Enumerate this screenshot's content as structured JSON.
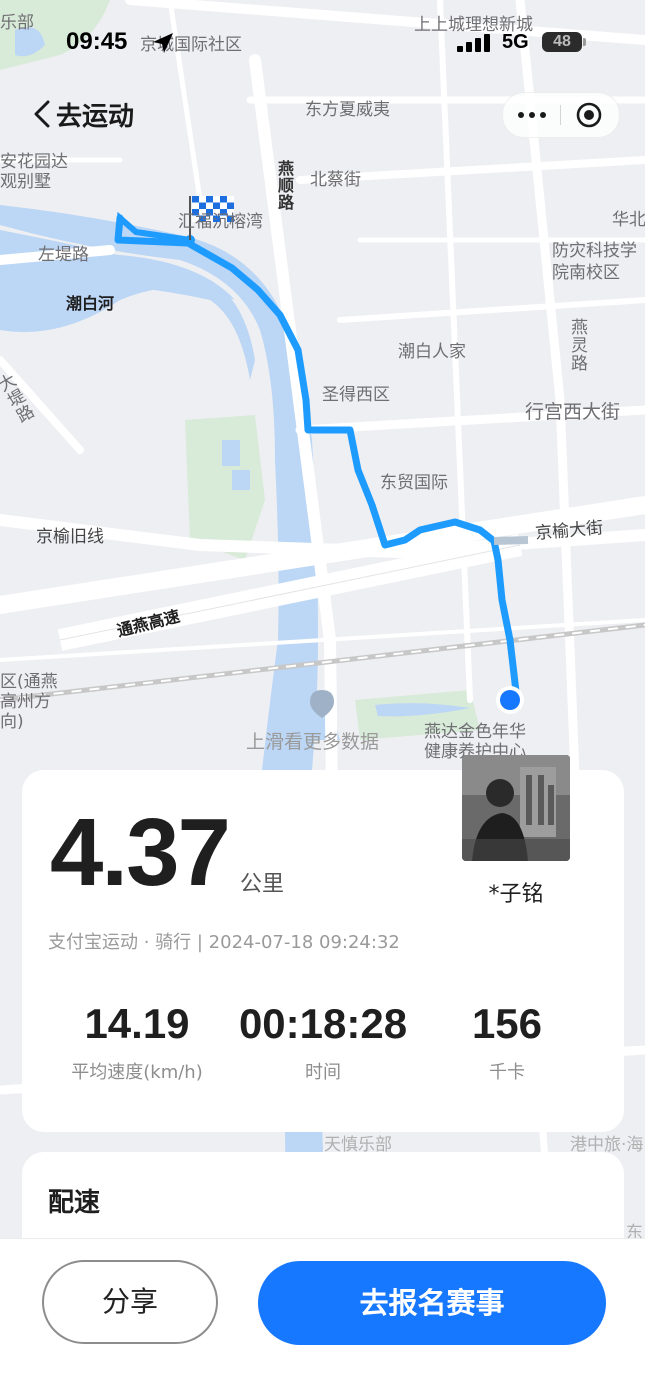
{
  "status_bar": {
    "time": "09:45",
    "network": "5G",
    "battery": "48"
  },
  "nav": {
    "title": "去运动"
  },
  "map": {
    "labels": {
      "l1": "上上城理想新城",
      "l2": "京城国际社区",
      "l3": "东方夏威夷",
      "l4": "北蔡街",
      "l5": "燕顺路",
      "l6": "汇福沉榕湾",
      "l7": "华北",
      "l8": "防灾科技学院南校区",
      "l9": "左堤路",
      "l10": "潮白河",
      "l11": "潮白人家",
      "l12": "燕灵路",
      "l13": "圣得西区",
      "l14": "行宫西大街",
      "l15": "东贸国际",
      "l16": "京榆旧线",
      "l17": "京榆大街",
      "l18": "通燕高速",
      "l19": "区(通燕高州方向)",
      "l20": "上滑看更多数据",
      "l21": "燕达金色年华健康养护中心",
      "l22": "大堤路",
      "l23": "安花园达观别墅",
      "l24": "乐部",
      "l25": "天慎乐部",
      "l26": "港中旅·海",
      "l27": "东"
    }
  },
  "workout": {
    "distance": "4.37",
    "distance_unit": "公里",
    "meta": "支付宝运动 · 骑行 | 2024-07-18 09:24:32",
    "user_name": "*子铭",
    "stats": {
      "speed_value": "14.19",
      "speed_label": "平均速度(km/h)",
      "time_value": "00:18:28",
      "time_label": "时间",
      "calories_value": "156",
      "calories_label": "千卡"
    }
  },
  "pace_section": {
    "title": "配速"
  },
  "actions": {
    "share": "分享",
    "signup": "去报名赛事"
  },
  "colors": {
    "route": "#1e9bff",
    "river": "#bcd6f5",
    "primary": "#1677ff"
  }
}
